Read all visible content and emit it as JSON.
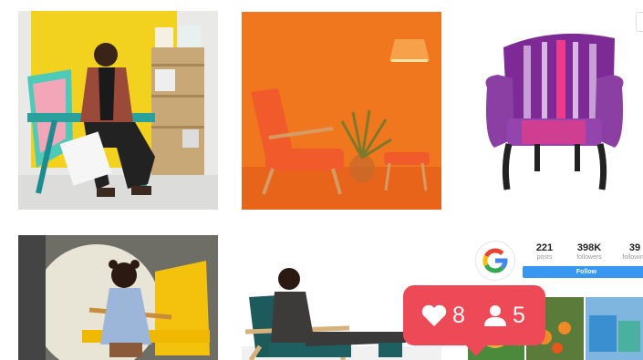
{
  "profile": {
    "stats": [
      {
        "value": "221",
        "label": "posts"
      },
      {
        "value": "398K",
        "label": "followers"
      },
      {
        "value": "39",
        "label": "following"
      }
    ],
    "follow_label": "Follow"
  },
  "notification": {
    "likes_count": "8",
    "followers_count": "5",
    "like_icon": "heart-icon",
    "follower_icon": "person-icon"
  },
  "colors": {
    "notification_bg": "#ed4956",
    "follow_button": "#3897f0"
  }
}
